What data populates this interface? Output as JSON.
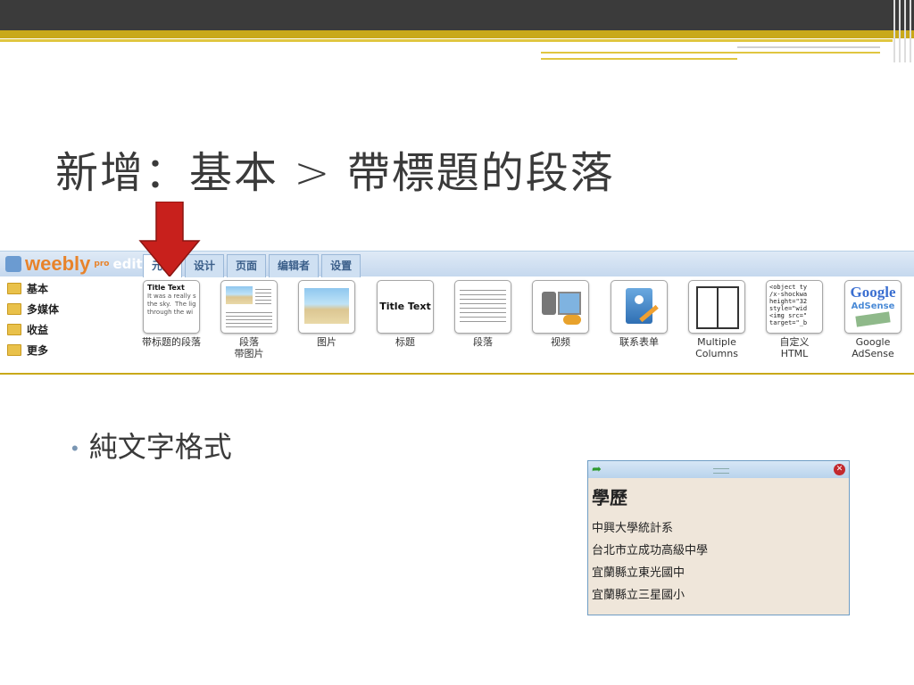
{
  "slide": {
    "title": "新增：基本 > 帶標題的段落",
    "bullet": "純文字格式"
  },
  "editor": {
    "logo_text": "weebly",
    "logo_pro": "pro",
    "logo_editor": "editor",
    "tabs": [
      "元素",
      "设计",
      "页面",
      "编辑者",
      "设置"
    ],
    "sidebar": [
      "基本",
      "多媒体",
      "收益",
      "更多"
    ],
    "elements": [
      {
        "label": "带标题的段落",
        "icon": "title-paragraph-icon",
        "thumb_title": "Title Text",
        "thumb_text": "It was a really s\nthe sky.  The lig\nthrough the wi"
      },
      {
        "label": "段落\n带图片",
        "icon": "paragraph-image-icon"
      },
      {
        "label": "图片",
        "icon": "image-icon"
      },
      {
        "label": "标题",
        "icon": "title-icon",
        "thumb_title": "Title Text"
      },
      {
        "label": "段落",
        "icon": "paragraph-icon"
      },
      {
        "label": "视频",
        "icon": "video-icon"
      },
      {
        "label": "联系表单",
        "icon": "contact-form-icon"
      },
      {
        "label": "Multiple\nColumns",
        "icon": "columns-icon"
      },
      {
        "label": "自定义\nHTML",
        "icon": "custom-html-icon",
        "thumb_code": "<object ty\n/x-shockwa\nheight=\"32\nstyle=\"wid\n<img src=\"\ntarget=\"_b"
      },
      {
        "label": "Google\nAdSense",
        "icon": "adsense-icon",
        "thumb_brand": "Google",
        "thumb_sub": "AdSense"
      }
    ]
  },
  "widget": {
    "heading": "學歷",
    "lines": [
      "中興大學統計系",
      "台北市立成功高級中學",
      "宜蘭縣立東光國中",
      "宜蘭縣立三星國小"
    ]
  },
  "colors": {
    "accent_gold": "#c9a91a",
    "arrow_red": "#c8201c",
    "topbar": "#3b3b3b"
  }
}
